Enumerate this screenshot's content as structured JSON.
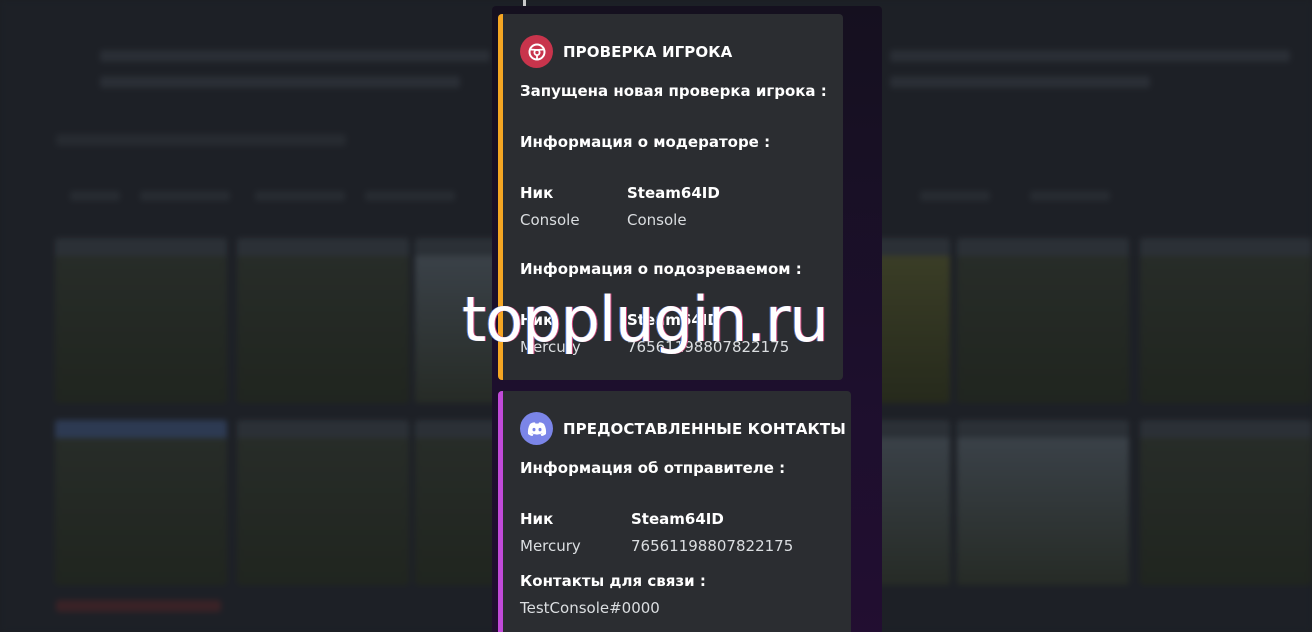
{
  "embeds": {
    "check": {
      "author_name": "ПРОВЕРКА ИГРОКА",
      "author_icon": "shield-icon",
      "accent_color": "#f5a623",
      "description": "Запущена новая проверка игрока :",
      "moderator_heading": "Информация о модераторе :",
      "moderator": {
        "nick_label": "Ник",
        "nick_value": "Console",
        "steam_label": "Steam64ID",
        "steam_value": "Console"
      },
      "suspect_heading": "Информация о подозреваемом :",
      "suspect": {
        "nick_label": "Ник",
        "nick_value": "Mercury",
        "steam_label": "Steam64ID",
        "steam_value": "76561198807822175"
      }
    },
    "contacts": {
      "author_name": "ПРЕДОСТАВЛЕННЫЕ КОНТАКТЫ",
      "author_icon": "discord-icon",
      "accent_color": "#c14ad9",
      "sender_heading": "Информация об отправителе :",
      "sender": {
        "nick_label": "Ник",
        "nick_value": "Mercury",
        "steam_label": "Steam64ID",
        "steam_value": "76561198807822175"
      },
      "contacts_label": "Контакты для связи :",
      "contacts_value": "TestConsole#0000"
    }
  },
  "watermark": "topplugin.ru"
}
